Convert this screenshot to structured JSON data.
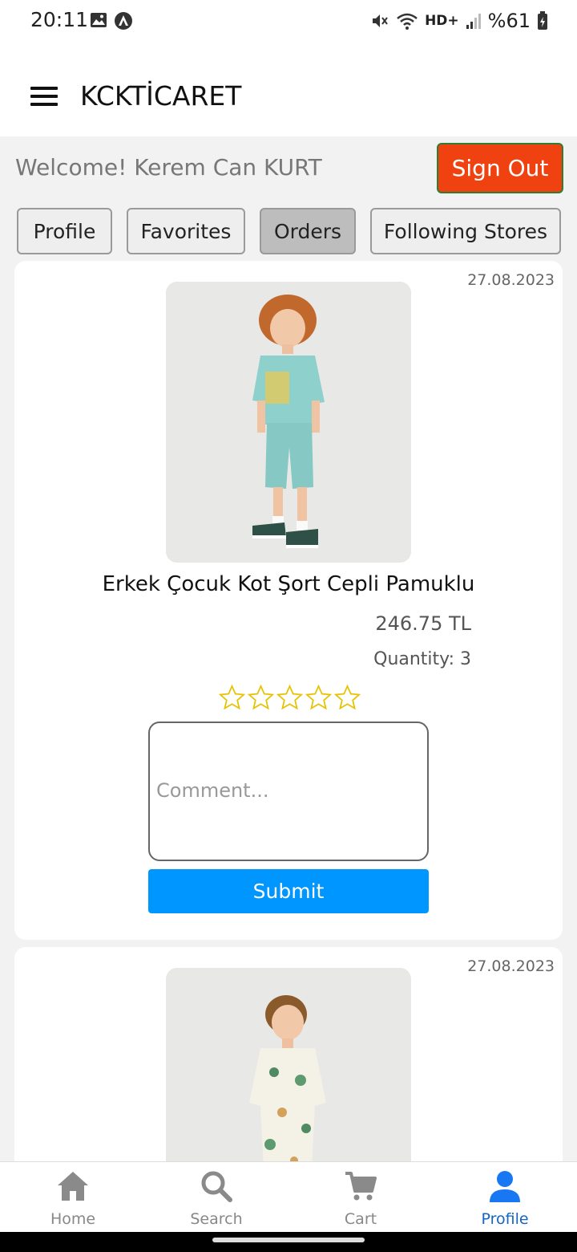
{
  "status_bar": {
    "time": "20:11",
    "network": "HD+",
    "battery": "%61"
  },
  "app": {
    "title": "KCKTİCARET"
  },
  "welcome": {
    "text": "Welcome! Kerem Can KURT",
    "sign_out_label": "Sign Out"
  },
  "tabs": [
    {
      "label": "Profile",
      "active": false
    },
    {
      "label": "Favorites",
      "active": false
    },
    {
      "label": "Orders",
      "active": true
    },
    {
      "label": "Following Stores",
      "active": false
    }
  ],
  "orders": [
    {
      "date": "27.08.2023",
      "name": "Erkek Çocuk Kot Şort Cepli Pamuklu",
      "price": "246.75 TL",
      "quantity": "Quantity: 3",
      "rating": 0,
      "max_rating": 5,
      "comment_placeholder": "Comment...",
      "submit_label": "Submit"
    },
    {
      "date": "27.08.2023"
    }
  ],
  "bottom_nav": [
    {
      "label": "Home",
      "icon": "home-icon",
      "active": false
    },
    {
      "label": "Search",
      "icon": "search-icon",
      "active": false
    },
    {
      "label": "Cart",
      "icon": "cart-icon",
      "active": false
    },
    {
      "label": "Profile",
      "icon": "profile-icon",
      "active": true
    }
  ],
  "colors": {
    "sign_out": "#f04210",
    "submit": "#0096ff",
    "active_nav": "#1565c0",
    "star_outline": "#e6c200"
  }
}
